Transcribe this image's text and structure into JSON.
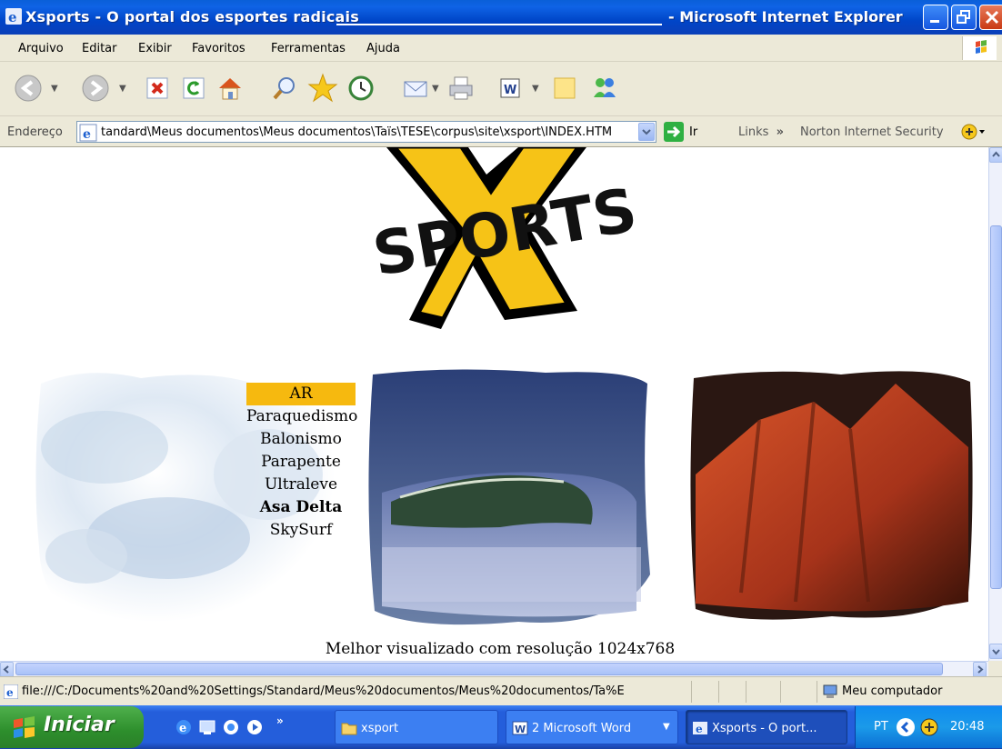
{
  "window": {
    "title": "Xsports - O portal dos esportes radicais",
    "app_name": "- Microsoft Internet Explorer"
  },
  "menubar": [
    "Arquivo",
    "Editar",
    "Exibir",
    "Favoritos",
    "Ferramentas",
    "Ajuda"
  ],
  "address": {
    "label": "Endereço",
    "value": "tandard\\Meus documentos\\Meus documentos\\Taïs\\TESE\\corpus\\site\\xsport\\INDEX.HTM",
    "go_label": "Ir",
    "links_label": "Links",
    "links_chevron": "»",
    "norton_label": "Norton Internet Security"
  },
  "page": {
    "logo_text": "SPORTS",
    "logo_letter": "X",
    "menu_heading": "AR",
    "menu_items": [
      "Paraquedismo",
      "Balonismo",
      "Parapente",
      "Ultraleve",
      "Asa Delta",
      "SkySurf"
    ],
    "footer": "Melhor visualizado com resolução 1024x768"
  },
  "status": {
    "url": "file:///C:/Documents%20and%20Settings/Standard/Meus%20documentos/Meus%20documentos/Ta%E",
    "zone": "Meu computador"
  },
  "taskbar": {
    "start_label": "Iniciar",
    "overflow_chevron": "»",
    "tasks": [
      "xsport",
      "2 Microsoft Word",
      "Xsports - O port..."
    ],
    "language": "PT",
    "clock": "20:48"
  },
  "colors": {
    "accent": "#f6b90f",
    "titlebar": "#0a5fd8",
    "taskbar": "#245edb"
  },
  "icons": [
    "ie-icon",
    "back-icon",
    "forward-icon",
    "stop-icon",
    "refresh-icon",
    "home-icon",
    "search-icon",
    "favorites-icon",
    "history-icon",
    "mail-icon",
    "print-icon",
    "word-icon",
    "note-icon",
    "messenger-icon",
    "go-icon",
    "norton-icon",
    "computer-icon"
  ]
}
